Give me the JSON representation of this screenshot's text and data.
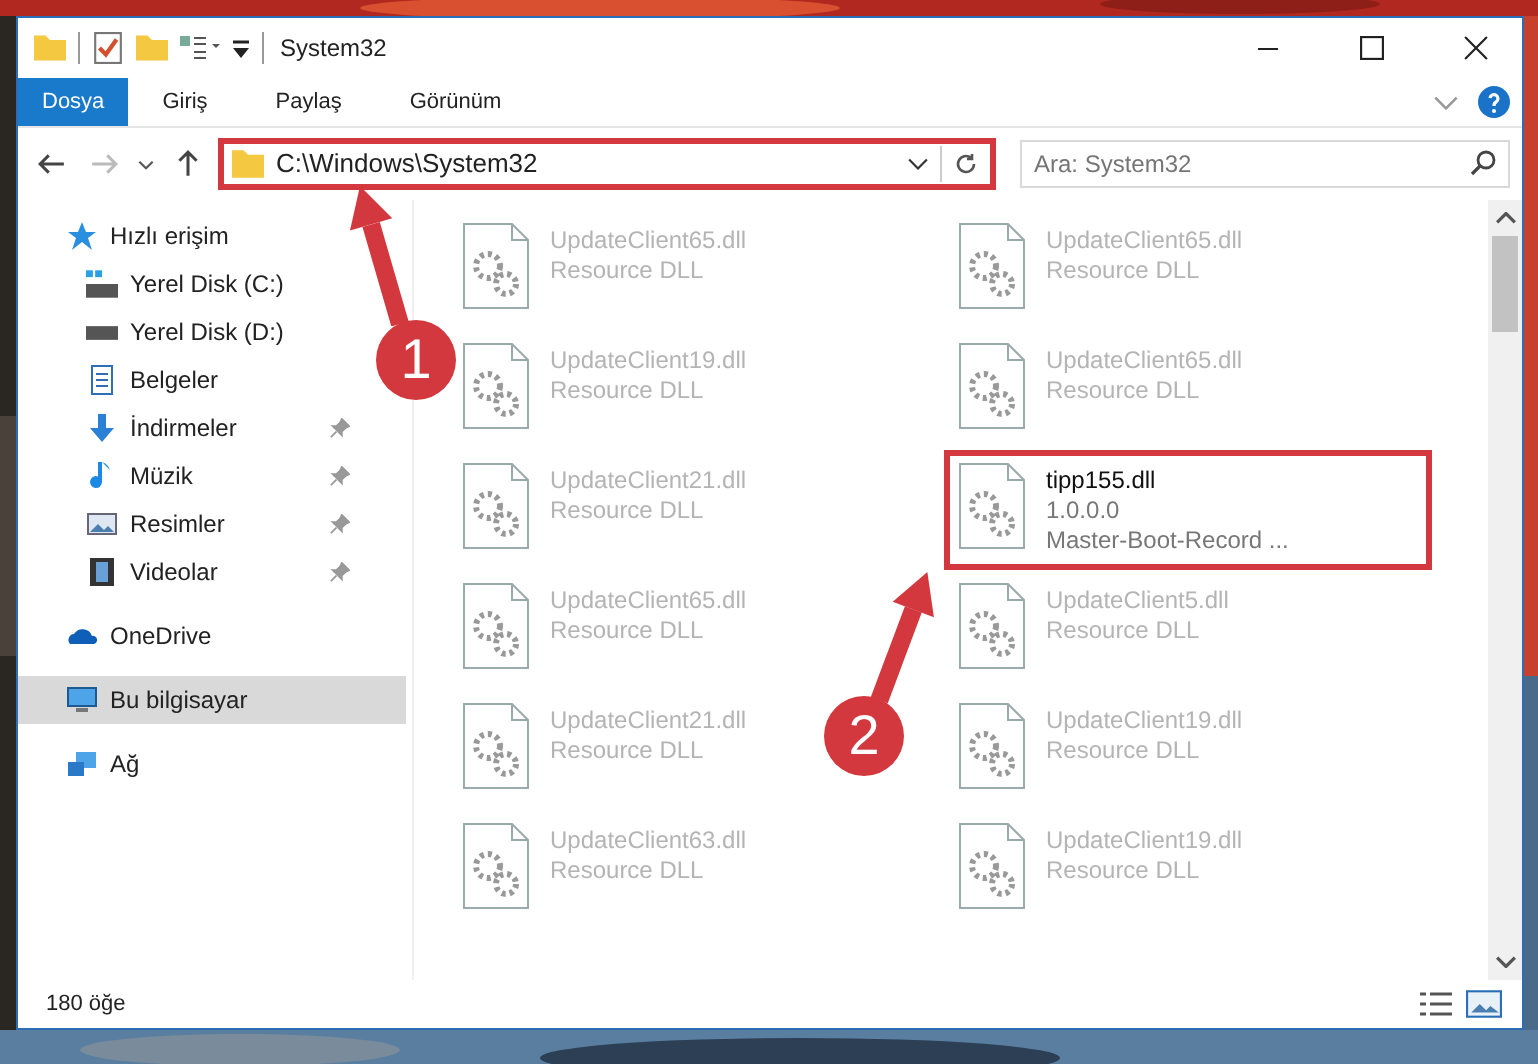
{
  "window": {
    "title": "System32"
  },
  "ribbon_tabs": [
    {
      "label": "Dosya",
      "kind": "file"
    },
    {
      "label": "Giriş",
      "kind": "tab"
    },
    {
      "label": "Paylaş",
      "kind": "tab"
    },
    {
      "label": "Görünüm",
      "kind": "tab"
    }
  ],
  "address_bar": {
    "path": "C:\\Windows\\System32",
    "highlighted": true
  },
  "search": {
    "placeholder": "Ara: System32"
  },
  "navigation": [
    {
      "label": "Hızlı erişim",
      "kind": "star",
      "selected": false,
      "children": [
        {
          "label": "Yerel Disk (C:)",
          "kind": "system-drive",
          "selected": false,
          "pinned": false
        },
        {
          "label": "Yerel Disk (D:)",
          "kind": "drive",
          "selected": false,
          "pinned": false
        },
        {
          "label": "Belgeler",
          "kind": "document",
          "selected": false,
          "pinned": false
        },
        {
          "label": "İndirmeler",
          "kind": "download",
          "selected": false,
          "pinned": true
        },
        {
          "label": "Müzik",
          "kind": "music",
          "selected": false,
          "pinned": true
        },
        {
          "label": "Resimler",
          "kind": "pictures",
          "selected": false,
          "pinned": true
        },
        {
          "label": "Videolar",
          "kind": "video",
          "selected": false,
          "pinned": true
        }
      ]
    },
    {
      "label": "OneDrive",
      "kind": "cloud",
      "selected": false
    },
    {
      "label": "Bu bilgisayar",
      "kind": "computer",
      "selected": true
    },
    {
      "label": "Ağ",
      "kind": "network",
      "selected": false
    }
  ],
  "files": [
    {
      "name": "UpdateClient65.dll",
      "details": [
        "Resource DLL"
      ],
      "blurred": true,
      "highlighted": false
    },
    {
      "name": "UpdateClient65.dll",
      "details": [
        "Resource DLL"
      ],
      "blurred": true,
      "highlighted": false
    },
    {
      "name": "UpdateClient19.dll",
      "details": [
        "Resource DLL"
      ],
      "blurred": true,
      "highlighted": false
    },
    {
      "name": "UpdateClient65.dll",
      "details": [
        "Resource DLL"
      ],
      "blurred": true,
      "highlighted": false
    },
    {
      "name": "UpdateClient21.dll",
      "details": [
        "Resource DLL"
      ],
      "blurred": true,
      "highlighted": false
    },
    {
      "name": "tipp155.dll",
      "details": [
        "1.0.0.0",
        "Master-Boot-Record ..."
      ],
      "blurred": false,
      "highlighted": true
    },
    {
      "name": "UpdateClient65.dll",
      "details": [
        "Resource DLL"
      ],
      "blurred": true,
      "highlighted": false
    },
    {
      "name": "UpdateClient5.dll",
      "details": [
        "Resource DLL"
      ],
      "blurred": true,
      "highlighted": false
    },
    {
      "name": "UpdateClient21.dll",
      "details": [
        "Resource DLL"
      ],
      "blurred": true,
      "highlighted": false
    },
    {
      "name": "UpdateClient19.dll",
      "details": [
        "Resource DLL"
      ],
      "blurred": true,
      "highlighted": false
    },
    {
      "name": "UpdateClient63.dll",
      "details": [
        "Resource DLL"
      ],
      "blurred": true,
      "highlighted": false
    },
    {
      "name": "UpdateClient19.dll",
      "details": [
        "Resource DLL"
      ],
      "blurred": true,
      "highlighted": false
    }
  ],
  "status_bar": {
    "item_count": "180 öğe"
  },
  "callouts": [
    {
      "number": "1"
    },
    {
      "number": "2"
    }
  ]
}
